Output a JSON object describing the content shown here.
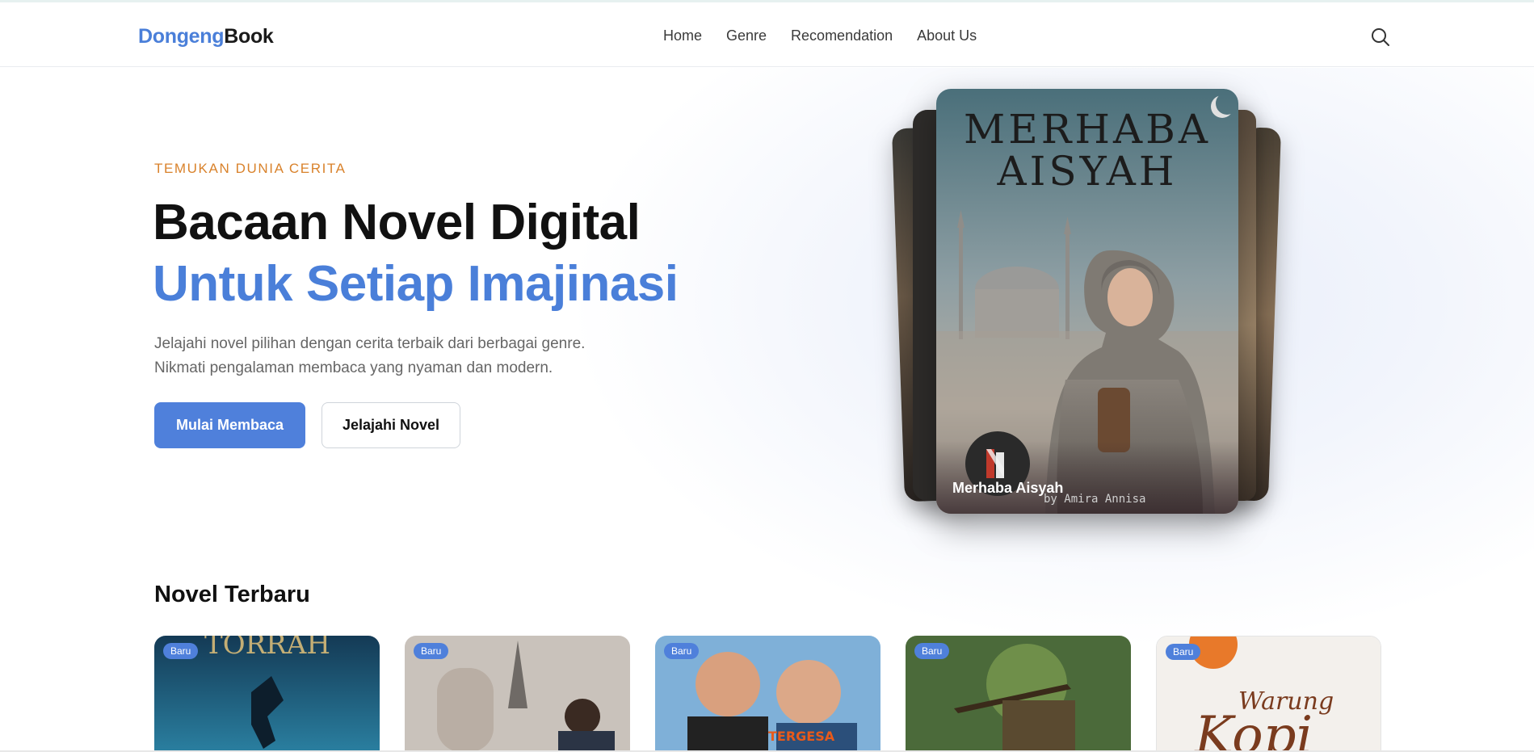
{
  "brand": {
    "part1": "Dongeng",
    "part2": "Book"
  },
  "nav": {
    "items": [
      "Home",
      "Genre",
      "Recomendation",
      "About Us"
    ]
  },
  "hero": {
    "eyebrow": "TEMUKAN DUNIA CERITA",
    "title_line1": "Bacaan Novel Digital",
    "title_line2": "Untuk Setiap Imajinasi",
    "desc_line1": "Jelajahi novel pilihan dengan cerita terbaik dari berbagai genre.",
    "desc_line2": "Nikmati pengalaman membaca yang nyaman dan modern.",
    "primary_button": "Mulai Membaca",
    "secondary_button": "Jelajahi Novel"
  },
  "featured": {
    "cover_title_line1": "MERHABA",
    "cover_title_line2": "AISYAH",
    "name": "Merhaba Aisyah",
    "author": "by Amira Annisa"
  },
  "latest": {
    "title": "Novel Terbaru",
    "cards": [
      {
        "badge": "Baru"
      },
      {
        "badge": "Baru"
      },
      {
        "badge": "Baru"
      },
      {
        "badge": "Baru"
      },
      {
        "badge": "Baru"
      }
    ]
  },
  "colors": {
    "accent": "#4a7fd9",
    "eyebrow": "#d9822b"
  }
}
